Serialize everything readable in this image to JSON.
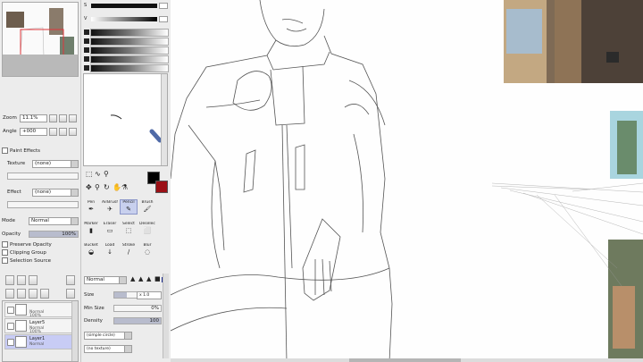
{
  "navigator": {
    "zoom_label": "Zoom",
    "zoom_value": "11.1%",
    "angle_label": "Angle",
    "angle_value": "+000"
  },
  "paint_effects": {
    "title": "Paint Effects",
    "texture_label": "Texture",
    "texture_value": "(none)",
    "effect_label": "Effect",
    "effect_value": "(none)"
  },
  "layer_props": {
    "mode_label": "Mode",
    "mode_value": "Normal",
    "opacity_label": "Opacity",
    "opacity_value": "100%",
    "opacity_level": 1.0,
    "options": [
      "Preserve Opacity",
      "Clipping Group",
      "Selection Source"
    ]
  },
  "layers": [
    {
      "name": "",
      "mode": "Normal",
      "opacity": "100%",
      "selected": false
    },
    {
      "name": "Layer5",
      "mode": "Normal",
      "opacity": "100%",
      "selected": false
    },
    {
      "name": "Layer1",
      "mode": "Normal",
      "opacity": "",
      "selected": true
    }
  ],
  "tool_tabs": [
    {
      "name": "Pen",
      "icon": "pen-icon",
      "glyph": "✒",
      "selected": false
    },
    {
      "name": "AirBrush",
      "icon": "airbrush-icon",
      "glyph": "✈",
      "selected": false
    },
    {
      "name": "Pencil",
      "icon": "pencil-icon",
      "glyph": "✎",
      "selected": true
    },
    {
      "name": "Brush",
      "icon": "brush-icon",
      "glyph": "🖌",
      "selected": false
    },
    {
      "name": "Marker",
      "icon": "marker-icon",
      "glyph": "▮",
      "selected": false
    },
    {
      "name": "Eraser",
      "icon": "eraser-icon",
      "glyph": "▭",
      "selected": false
    },
    {
      "name": "Select",
      "icon": "select-icon",
      "glyph": "⬚",
      "selected": false
    },
    {
      "name": "Deselect",
      "icon": "deselect-icon",
      "glyph": "⬜",
      "selected": false
    },
    {
      "name": "Bucket",
      "icon": "bucket-icon",
      "glyph": "◒",
      "selected": false
    },
    {
      "name": "Load",
      "icon": "load-icon",
      "glyph": "↓",
      "selected": false
    },
    {
      "name": "Stroke",
      "icon": "stroke-icon",
      "glyph": "∕",
      "selected": false
    },
    {
      "name": "Blur",
      "icon": "blur-icon",
      "glyph": "◌",
      "selected": false
    }
  ],
  "tool_settings": {
    "blend_mode": "Normal",
    "size_label": "Size",
    "size_value": "x 1.0",
    "min_size_label": "Min Size",
    "min_size_value": "0%",
    "density_label": "Density",
    "density_value": "100",
    "density_level": 1.0,
    "shape_value": "(simple circle)",
    "texture_value": "(no texture)"
  },
  "colors": {
    "accent_selected": "#c8ccf5",
    "foreground": "#000000",
    "background": "#9b1016",
    "selection_frame": "#e0353a"
  }
}
